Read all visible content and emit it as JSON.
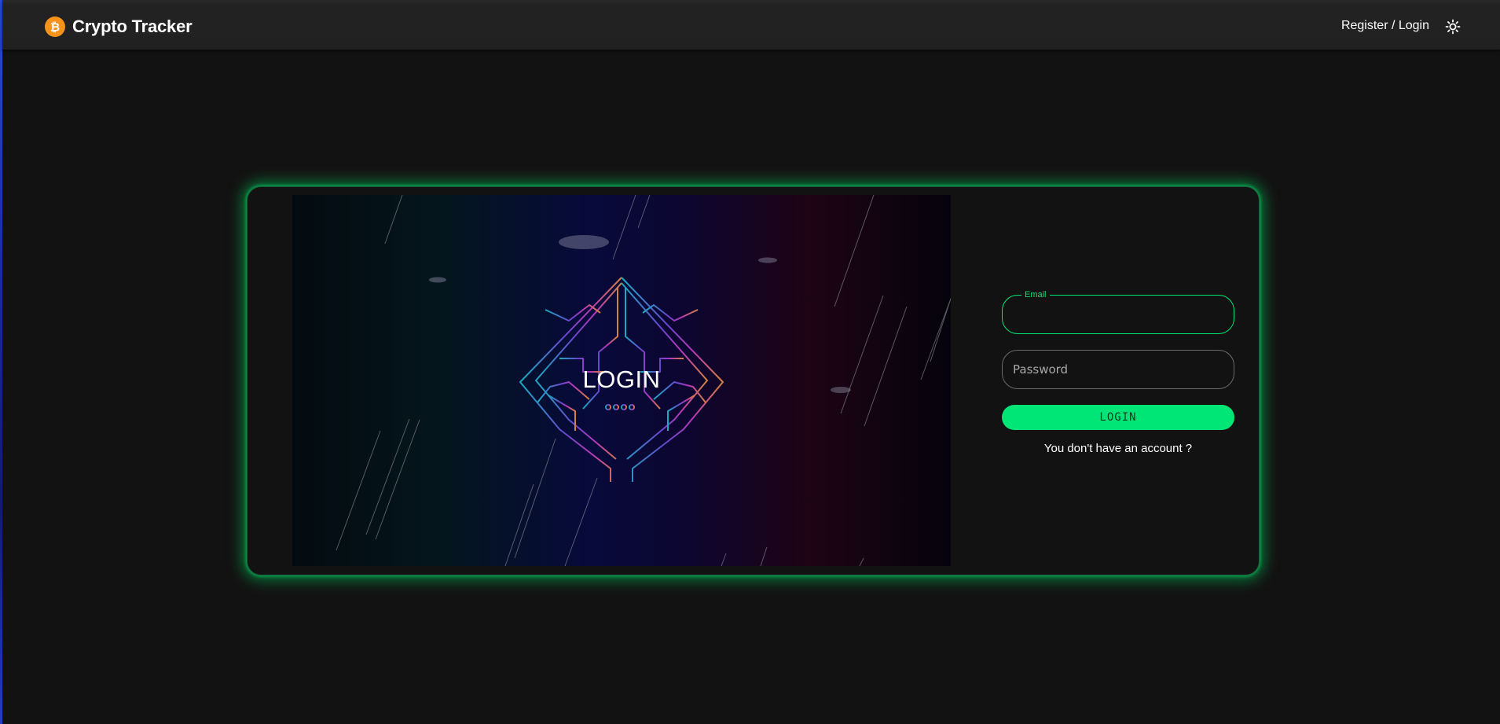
{
  "app": {
    "title": "Crypto Tracker",
    "logo_icon": "bitcoin-icon",
    "brand_color": "#f7931a"
  },
  "header": {
    "nav_link": "Register / Login",
    "theme_toggle_icon": "sun-icon"
  },
  "hero": {
    "text": "LOGIN",
    "illustration": "neon-circuit-diamond-illustration"
  },
  "login_form": {
    "email": {
      "label": "Email",
      "value": "",
      "placeholder": ""
    },
    "password": {
      "label": "Password",
      "value": "",
      "placeholder": "Password"
    },
    "submit_label": "LOGIN",
    "signup_prompt": "You don't have an account ?"
  },
  "colors": {
    "accent": "#00e676",
    "background": "#121212",
    "appbar": "#212121"
  }
}
